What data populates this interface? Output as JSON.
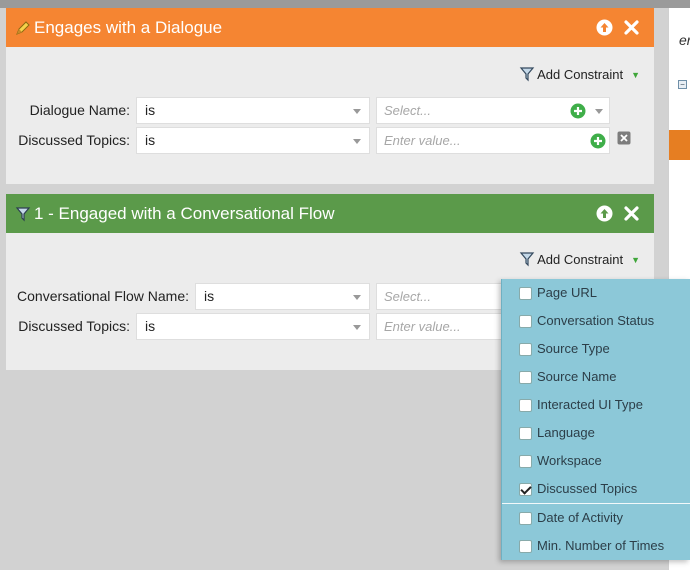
{
  "right_column": {
    "partial_text": "er"
  },
  "panel1": {
    "title": "Engages with a Dialogue",
    "header_color": "#f58532",
    "add_constraint": "Add Constraint",
    "rows": [
      {
        "label": "Dialogue Name:",
        "operator": "is",
        "value_placeholder": "Select..."
      },
      {
        "label": "Discussed Topics:",
        "operator": "is",
        "value_placeholder": "Enter value..."
      }
    ]
  },
  "panel2": {
    "title": "1 - Engaged with a Conversational Flow",
    "header_color": "#5b9a4a",
    "add_constraint": "Add Constraint",
    "rows": [
      {
        "label": "Conversational Flow Name:",
        "operator": "is",
        "value_placeholder": "Select..."
      },
      {
        "label": "Discussed Topics:",
        "operator": "is",
        "value_placeholder": "Enter value..."
      }
    ]
  },
  "constraint_menu": {
    "background": "#8cc8d8",
    "items": [
      {
        "label": "Page URL",
        "checked": false
      },
      {
        "label": "Conversation Status",
        "checked": false
      },
      {
        "label": "Source Type",
        "checked": false
      },
      {
        "label": "Source Name",
        "checked": false
      },
      {
        "label": "Interacted UI Type",
        "checked": false
      },
      {
        "label": "Language",
        "checked": false
      },
      {
        "label": "Workspace",
        "checked": false
      },
      {
        "label": "Discussed Topics",
        "checked": true
      },
      {
        "label": "Date of Activity",
        "checked": false
      },
      {
        "label": "Min. Number of Times",
        "checked": false
      }
    ]
  },
  "icons": {
    "panel1_header": "pencil-icon",
    "panel2_header": "filter-flag-icon",
    "move_up": "move-up-icon",
    "close": "close-icon",
    "add_value": "plus-circle-icon",
    "remove_row": "remove-row-icon"
  }
}
